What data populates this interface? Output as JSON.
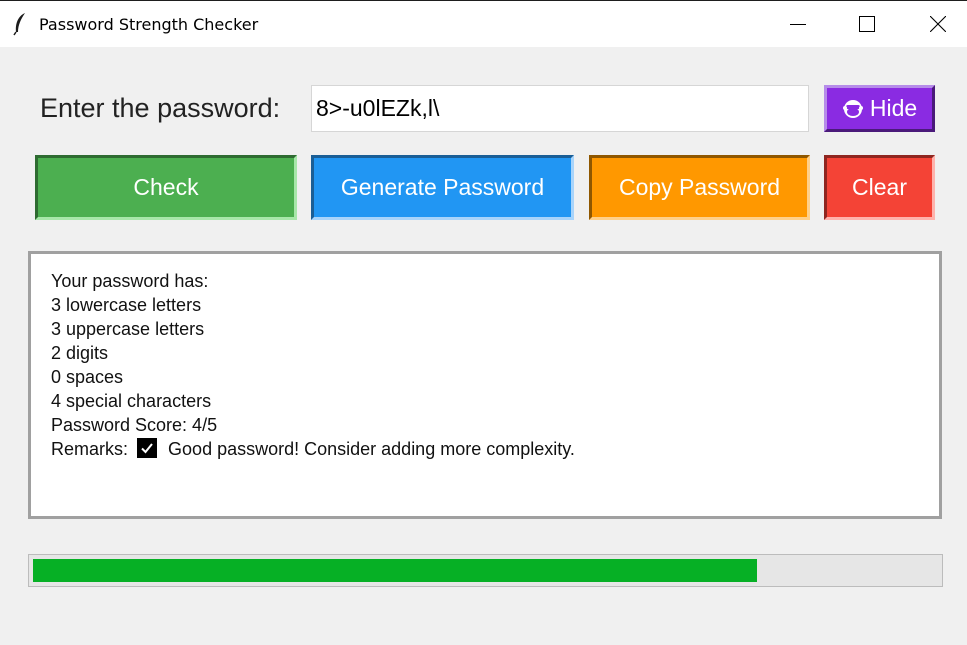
{
  "window": {
    "title": "Password Strength Checker",
    "app_icon": "feather-icon",
    "controls": [
      "minimize-icon",
      "maximize-icon",
      "close-icon"
    ]
  },
  "form": {
    "prompt_label": "Enter the password:",
    "password_value": "8>-u0lEZk,l\\",
    "hide_button": {
      "label": "Hide",
      "icon": "see-no-evil-monkey-icon",
      "color": "#8a2be2"
    }
  },
  "actions": {
    "check": {
      "label": "Check",
      "color": "#4caf50"
    },
    "generate": {
      "label": "Generate Password",
      "color": "#2196f3"
    },
    "copy": {
      "label": "Copy Password",
      "color": "#ff9800"
    },
    "clear": {
      "label": "Clear",
      "color": "#f44336"
    }
  },
  "result": {
    "heading": "Your password has:",
    "lines": [
      "3 lowercase letters",
      "3 uppercase letters",
      "2 digits",
      "0 spaces",
      "4 special characters",
      "Password Score: 4/5"
    ],
    "remarks_label": "Remarks:",
    "remarks_icon": "check-mark-icon",
    "remarks_text": "Good password! Consider adding more complexity."
  },
  "strength": {
    "fraction": 0.8,
    "fill_color": "#06b025",
    "track_color": "#e6e6e6"
  }
}
